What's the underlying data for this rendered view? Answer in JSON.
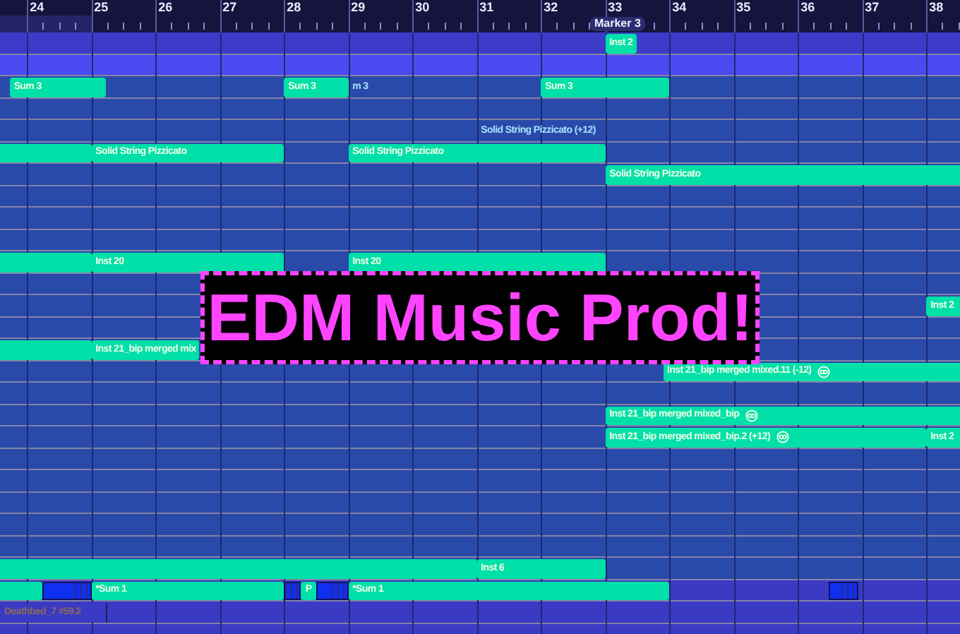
{
  "ruler": {
    "bars": [
      "24",
      "25",
      "26",
      "27",
      "28",
      "29",
      "30",
      "31",
      "32",
      "33",
      "34",
      "35",
      "36",
      "37",
      "38"
    ],
    "marker": "Marker 3"
  },
  "clips": [
    {
      "label": "Inst 2",
      "kind": "clip",
      "linked": false
    },
    {
      "label": "Sum 3",
      "kind": "clip",
      "linked": false
    },
    {
      "label": "Sum 3",
      "kind": "clip",
      "linked": false
    },
    {
      "label": "m 3",
      "kind": "ghost",
      "linked": false
    },
    {
      "label": "Sum 3",
      "kind": "clip",
      "linked": false
    },
    {
      "label": "Solid String Pizzicato (+12)",
      "kind": "ghost",
      "linked": false
    },
    {
      "label": "Solid String Pizzicato",
      "kind": "clip",
      "linked": false
    },
    {
      "label": "Solid String Pizzicato",
      "kind": "clip",
      "linked": false
    },
    {
      "label": "Solid String Pizzicato",
      "kind": "clip",
      "linked": false
    },
    {
      "label": "Inst 20",
      "kind": "clip",
      "linked": false
    },
    {
      "label": "Inst 20",
      "kind": "clip",
      "linked": false
    },
    {
      "label": "Inst 2",
      "kind": "clip",
      "linked": false
    },
    {
      "label": "Inst 21_bip merged mix",
      "kind": "clip",
      "linked": false
    },
    {
      "label": "Inst 21_bip merged mixed.11 (-12)",
      "kind": "clip",
      "linked": true
    },
    {
      "label": "Inst 21_bip merged mixed_bip",
      "kind": "clip",
      "linked": true
    },
    {
      "label": "Inst 21_bip merged mixed_bip.2 (+12)",
      "kind": "clip",
      "linked": true
    },
    {
      "label": "Inst 2",
      "kind": "clip",
      "linked": false
    },
    {
      "label": "Inst 6",
      "kind": "clip",
      "linked": false
    },
    {
      "label": "*Sum 1",
      "kind": "clip",
      "linked": false
    },
    {
      "label": "P",
      "kind": "clip",
      "linked": false
    },
    {
      "label": "*Sum 1",
      "kind": "clip",
      "linked": false
    },
    {
      "label": "Deathbed_7 #59.2",
      "kind": "outline",
      "linked": false
    }
  ],
  "banner": {
    "text": "EDM Music Prod!"
  }
}
